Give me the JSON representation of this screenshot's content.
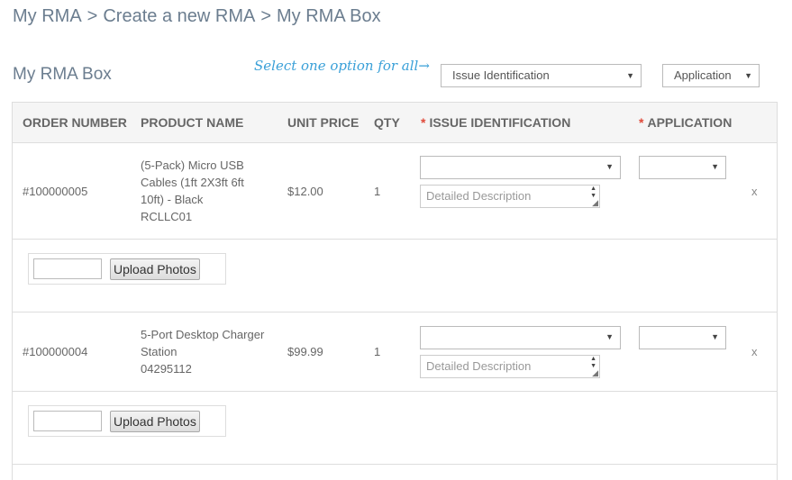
{
  "breadcrumb": {
    "item1": "My RMA",
    "sep1": ">",
    "item2": "Create a new RMA",
    "sep2": ">",
    "item3": "My RMA Box"
  },
  "box_title": "My RMA Box",
  "select_hint": "Select one option for all→",
  "bulk": {
    "issue_select": "Issue Identification",
    "application_select": "Application",
    "caret": "▼"
  },
  "table": {
    "headers": {
      "order_number": "ORDER NUMBER",
      "product_name": "PRODUCT NAME",
      "unit_price": "UNIT PRICE",
      "qty": "QTY",
      "required_mark": "*",
      "issue_identification": "ISSUE IDENTIFICATION",
      "application": "APPLICATION"
    },
    "rows": [
      {
        "order_number": "#100000005",
        "product_lines": [
          "(5-Pack) Micro USB",
          "Cables (1ft 2X3ft 6ft",
          "10ft) - Black",
          "RCLLC01"
        ],
        "unit_price": "$12.00",
        "qty": "1",
        "description_placeholder": "Detailed Description",
        "remove": "x",
        "upload_label": "Upload Photos"
      },
      {
        "order_number": "#100000004",
        "product_lines": [
          "5-Port Desktop Charger",
          "Station",
          "04295112"
        ],
        "unit_price": "$99.99",
        "qty": "1",
        "description_placeholder": "Detailed Description",
        "remove": "x",
        "upload_label": "Upload Photos"
      }
    ]
  }
}
